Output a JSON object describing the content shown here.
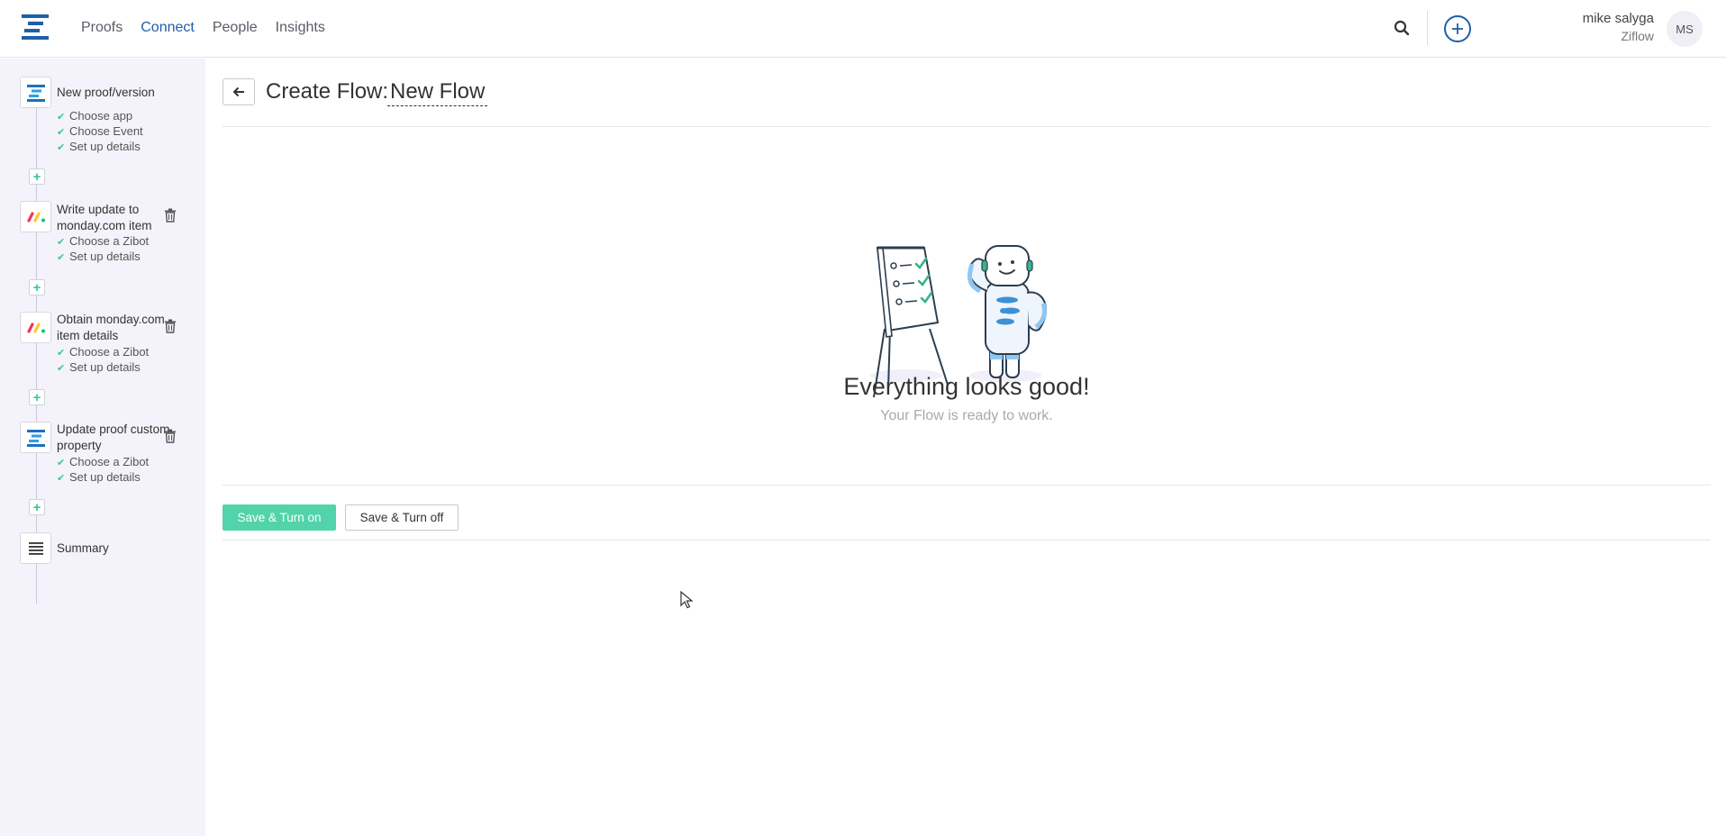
{
  "nav": {
    "items": [
      {
        "label": "Proofs",
        "active": false
      },
      {
        "label": "Connect",
        "active": true
      },
      {
        "label": "People",
        "active": false
      },
      {
        "label": "Insights",
        "active": false
      }
    ]
  },
  "user": {
    "name": "mike salyga",
    "org": "Ziflow",
    "initials": "MS"
  },
  "sidebar": {
    "steps": [
      {
        "title": "New proof/version",
        "icon": "ziflow-icon",
        "subitems": [
          "Choose app",
          "Choose Event",
          "Set up details"
        ]
      },
      {
        "title": "Write update to monday.com item",
        "icon": "monday-icon",
        "subitems": [
          "Choose a Zibot",
          "Set up details"
        ]
      },
      {
        "title": "Obtain monday.com item details",
        "icon": "monday-icon",
        "subitems": [
          "Choose a Zibot",
          "Set up details"
        ]
      },
      {
        "title": "Update proof custom property",
        "icon": "ziflow-icon",
        "subitems": [
          "Choose a Zibot",
          "Set up details"
        ]
      },
      {
        "title": "Summary",
        "icon": "summary-icon",
        "subitems": []
      }
    ]
  },
  "main": {
    "title_label": "Create Flow:",
    "flow_name": "New Flow",
    "status_title": "Everything looks good!",
    "status_sub": "Your Flow is ready to work.",
    "save_on_label": "Save & Turn on",
    "save_off_label": "Save & Turn off"
  },
  "colors": {
    "brand_blue": "#1f5fa8",
    "accent_green": "#52d3a9",
    "check_green": "#3bc59a",
    "sidebar_bg": "#f4f3fb"
  }
}
